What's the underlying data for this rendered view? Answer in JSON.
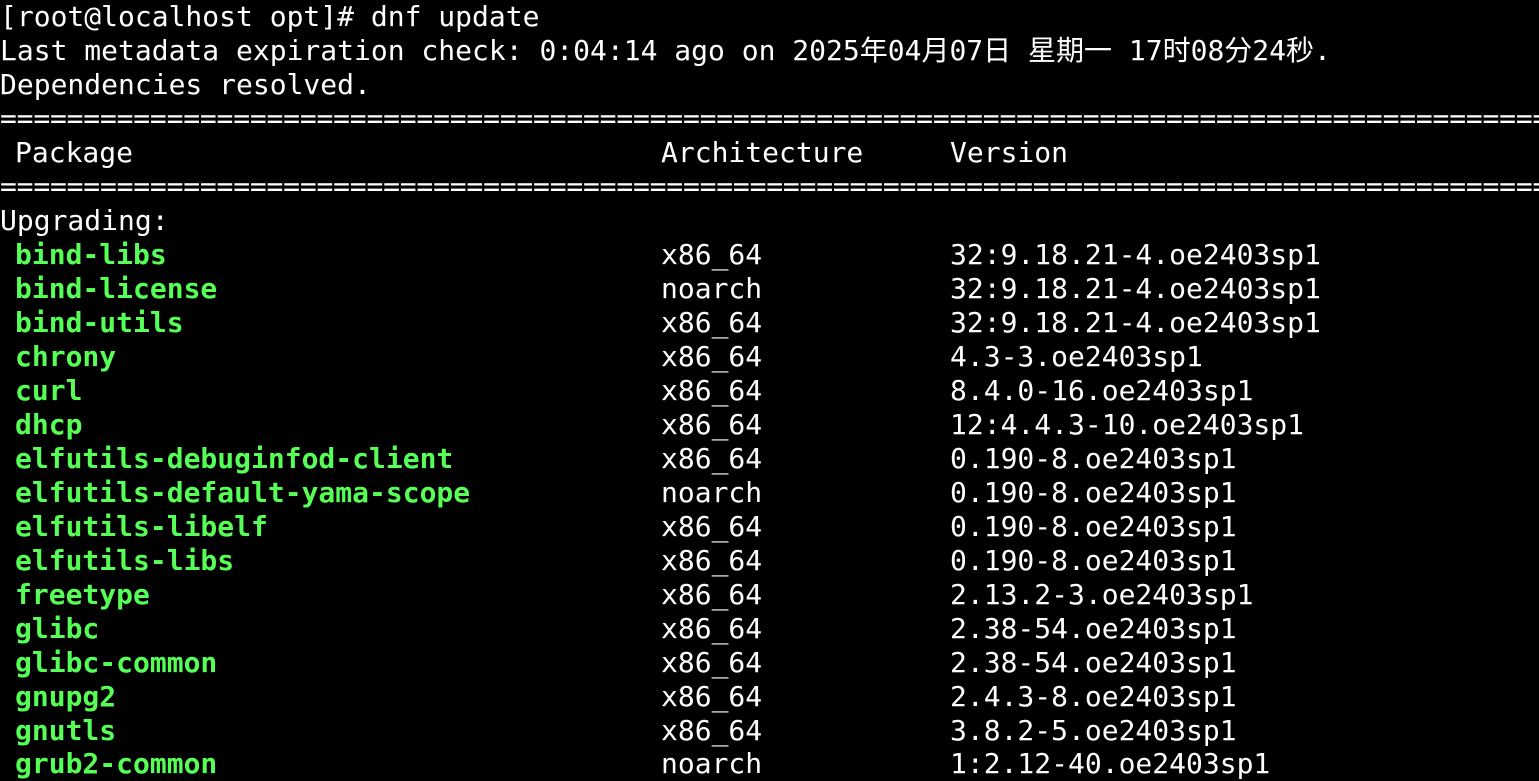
{
  "terminal": {
    "prompt_line": "[root@localhost opt]# dnf update",
    "metadata_line": "Last metadata expiration check: 0:04:14 ago on 2025年04月07日 星期一 17时08分24秒.",
    "deps_line": "Dependencies resolved.",
    "separator": "==========================================================================================================",
    "header": {
      "package": "Package",
      "architecture": "Architecture",
      "version": "Version"
    },
    "section_label": "Upgrading:",
    "packages": [
      {
        "name": "bind-libs",
        "arch": "x86_64",
        "version": "32:9.18.21-4.oe2403sp1"
      },
      {
        "name": "bind-license",
        "arch": "noarch",
        "version": "32:9.18.21-4.oe2403sp1"
      },
      {
        "name": "bind-utils",
        "arch": "x86_64",
        "version": "32:9.18.21-4.oe2403sp1"
      },
      {
        "name": "chrony",
        "arch": "x86_64",
        "version": "4.3-3.oe2403sp1"
      },
      {
        "name": "curl",
        "arch": "x86_64",
        "version": "8.4.0-16.oe2403sp1"
      },
      {
        "name": "dhcp",
        "arch": "x86_64",
        "version": "12:4.4.3-10.oe2403sp1"
      },
      {
        "name": "elfutils-debuginfod-client",
        "arch": "x86_64",
        "version": "0.190-8.oe2403sp1"
      },
      {
        "name": "elfutils-default-yama-scope",
        "arch": "noarch",
        "version": "0.190-8.oe2403sp1"
      },
      {
        "name": "elfutils-libelf",
        "arch": "x86_64",
        "version": "0.190-8.oe2403sp1"
      },
      {
        "name": "elfutils-libs",
        "arch": "x86_64",
        "version": "0.190-8.oe2403sp1"
      },
      {
        "name": "freetype",
        "arch": "x86_64",
        "version": "2.13.2-3.oe2403sp1"
      },
      {
        "name": "glibc",
        "arch": "x86_64",
        "version": "2.38-54.oe2403sp1"
      },
      {
        "name": "glibc-common",
        "arch": "x86_64",
        "version": "2.38-54.oe2403sp1"
      },
      {
        "name": "gnupg2",
        "arch": "x86_64",
        "version": "2.4.3-8.oe2403sp1"
      },
      {
        "name": "gnutls",
        "arch": "x86_64",
        "version": "3.8.2-5.oe2403sp1"
      },
      {
        "name": "grub2-common",
        "arch": "noarch",
        "version": "1:2.12-40.oe2403sp1"
      }
    ],
    "colors": {
      "background": "#000000",
      "text": "#ffffff",
      "package_name": "#55ff55"
    }
  }
}
